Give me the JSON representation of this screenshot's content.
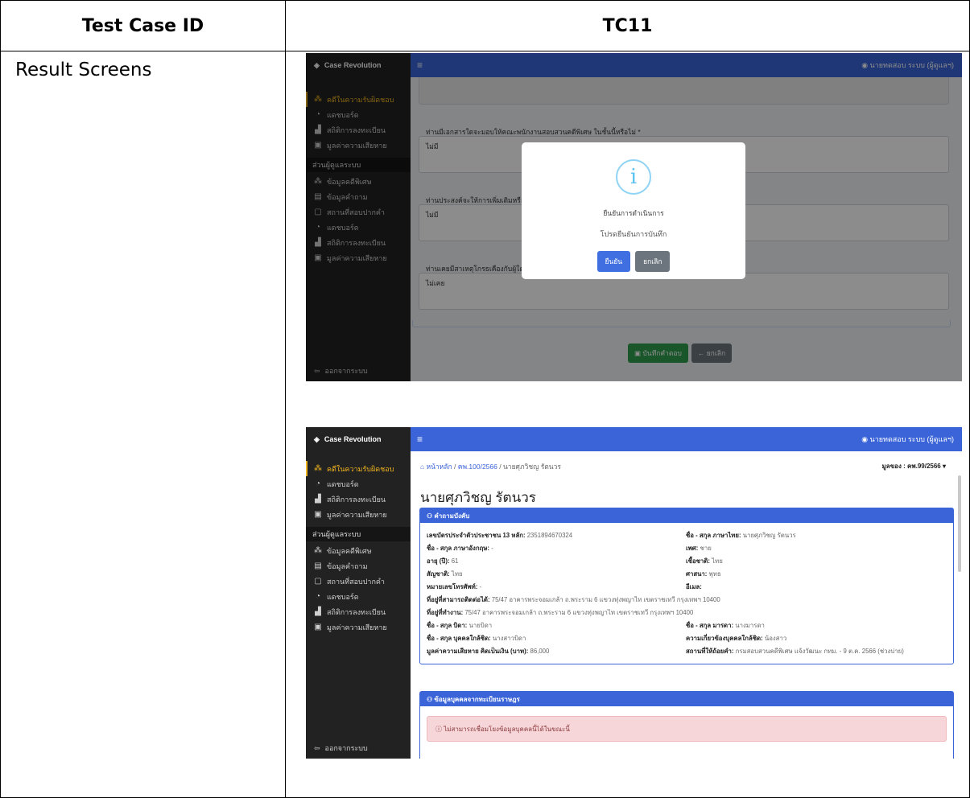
{
  "table": {
    "header_left": "Test Case ID",
    "header_right": "TC11",
    "row_label": "Result Screens"
  },
  "app": {
    "brand": "Case Revolution",
    "user": "นายทดสอบ ระบบ (ผู้ดูแลฯ)",
    "menu_icon": "hamburger-icon",
    "sidebar_items": [
      {
        "label": "คดีในความรับผิดชอบ",
        "icon": "grid-icon",
        "active": true
      },
      {
        "label": "แดชบอร์ด",
        "icon": "dashboard-icon",
        "active": false
      },
      {
        "label": "สถิติการลงทะเบียน",
        "icon": "chart-icon",
        "active": false
      },
      {
        "label": "มูลค่าความเสียหาย",
        "icon": "money-icon",
        "active": false
      }
    ],
    "sidebar_section": "ส่วนผู้ดูแลระบบ",
    "admin_items": [
      {
        "label": "ข้อมูลคดีพิเศษ",
        "icon": "grid-icon"
      },
      {
        "label": "ข้อมูลคำถาม",
        "icon": "message-icon"
      },
      {
        "label": "สถานที่สอบปากคำ",
        "icon": "building-icon"
      },
      {
        "label": "แดชบอร์ด",
        "icon": "dashboard-icon"
      },
      {
        "label": "สถิติการลงทะเบียน",
        "icon": "chart-icon"
      },
      {
        "label": "มูลค่าความเสียหาย",
        "icon": "money-icon"
      }
    ],
    "logout": "ออกจากระบบ"
  },
  "shot1": {
    "q1": "ท่านมีเอกสารใดจะมอบให้คณะพนักงานสอบสวนคดีพิเศษ ในชั้นนี้หรือไม่ *",
    "a1": "ไม่มี",
    "q2": "ท่านประสงค์จะให้การเพิ่มเติมหรือ",
    "a2": "ไม่มี",
    "q3": "ท่านเคยมีสาเหตุโกรธเคืองกับผู้ใด",
    "a3": "ไม่เคย",
    "save": "บันทึกคำตอบ",
    "cancel": "← ยกเลิก",
    "modal": {
      "icon": "i",
      "title": "ยืนยันการดำเนินการ",
      "message": "โปรดยืนยันการบันทึก",
      "confirm": "ยืนยัน",
      "cancel": "ยกเลิก"
    }
  },
  "shot2": {
    "breadcrumb": [
      "หน้าหลัก",
      "คพ.100/2566",
      "นายศุภวิชญ รัตนวร"
    ],
    "case_select": "มูลของ : คพ.99/2566",
    "name": "นายศุภวิชญ รัตนวร",
    "card1_title": "คำถามบังคับ",
    "fields": [
      {
        "k": "เลขบัตรประจำตัวประชาชน 13 หลัก:",
        "v": "2351894670324"
      },
      {
        "k": "ชื่อ - สกุล ภาษาไทย:",
        "v": "นายศุภวิชญ รัตนวร"
      },
      {
        "k": "ชื่อ - สกุล ภาษาอังกฤษ:",
        "v": "-"
      },
      {
        "k": "เพศ:",
        "v": "ชาย"
      },
      {
        "k": "อายุ (ปี):",
        "v": "61"
      },
      {
        "k": "เชื้อชาติ:",
        "v": "ไทย"
      },
      {
        "k": "สัญชาติ:",
        "v": "ไทย"
      },
      {
        "k": "ศาสนา:",
        "v": "พุทธ"
      },
      {
        "k": "หมายเลขโทรศัพท์:",
        "v": "-"
      },
      {
        "k": "อีเมล:",
        "v": ""
      },
      {
        "k": "ที่อยู่ที่สามารถติดต่อได้:",
        "v": "75/47 อาคารพระจอมเกล้า ถ.พระราม 6 แขวงทุ่งพญาไท เขตราชเทวี กรุงเทพฯ 10400"
      },
      {
        "k": "ที่อยู่ที่ทำงาน:",
        "v": "75/47 อาคารพระจอมเกล้า ถ.พระราม 6 แขวงทุ่งพญาไท เขตราชเทวี กรุงเทพฯ 10400"
      },
      {
        "k": "ชื่อ - สกุล บิดา:",
        "v": "นายบิดา"
      },
      {
        "k": "ชื่อ - สกุล มารดา:",
        "v": "นางมารดา"
      },
      {
        "k": "ชื่อ - สกุล บุคคลใกล้ชิด:",
        "v": "นางสาวบิดา"
      },
      {
        "k": "ความเกี่ยวข้องบุคคลใกล้ชิด:",
        "v": "น้องสาว"
      },
      {
        "k": "มูลค่าความเสียหาย คิดเป็นเงิน (บาท):",
        "v": "86,000"
      },
      {
        "k": "สถานที่ให้ถ้อยคำ:",
        "v": "กรมสอบสวนคดีพิเศษ แจ้งวัฒนะ กทม. - 9 ต.ค. 2566 (ช่วงบ่าย)"
      }
    ],
    "card2_title": "ข้อมูลบุคคลจากทะเบียนราษฎร",
    "alert": "ไม่สามารถเชื่อมโยงข้อมูลบุคคลนี้ได้ในขณะนี้"
  }
}
